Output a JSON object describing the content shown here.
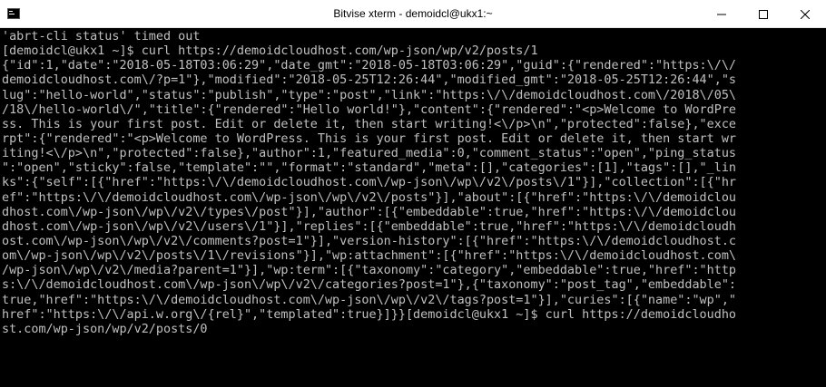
{
  "window": {
    "title": "Bitvise xterm - demoidcl@ukx1:~",
    "controls": {
      "minimize": "minimize",
      "maximize": "maximize",
      "close": "close"
    }
  },
  "terminal": {
    "lines": [
      "'abrt-cli status' timed out",
      "[demoidcl@ukx1 ~]$ curl https://demoidcloudhost.com/wp-json/wp/v2/posts/1",
      "{\"id\":1,\"date\":\"2018-05-18T03:06:29\",\"date_gmt\":\"2018-05-18T03:06:29\",\"guid\":{\"rendered\":\"https:\\/\\/",
      "demoidcloudhost.com\\/?p=1\"},\"modified\":\"2018-05-25T12:26:44\",\"modified_gmt\":\"2018-05-25T12:26:44\",\"s",
      "lug\":\"hello-world\",\"status\":\"publish\",\"type\":\"post\",\"link\":\"https:\\/\\/demoidcloudhost.com\\/2018\\/05\\",
      "/18\\/hello-world\\/\",\"title\":{\"rendered\":\"Hello world!\"},\"content\":{\"rendered\":\"<p>Welcome to WordPre",
      "ss. This is your first post. Edit or delete it, then start writing!<\\/p>\\n\",\"protected\":false},\"exce",
      "rpt\":{\"rendered\":\"<p>Welcome to WordPress. This is your first post. Edit or delete it, then start wr",
      "iting!<\\/p>\\n\",\"protected\":false},\"author\":1,\"featured_media\":0,\"comment_status\":\"open\",\"ping_status",
      "\":\"open\",\"sticky\":false,\"template\":\"\",\"format\":\"standard\",\"meta\":[],\"categories\":[1],\"tags\":[],\"_lin",
      "ks\":{\"self\":[{\"href\":\"https:\\/\\/demoidcloudhost.com\\/wp-json\\/wp\\/v2\\/posts\\/1\"}],\"collection\":[{\"hr",
      "ef\":\"https:\\/\\/demoidcloudhost.com\\/wp-json\\/wp\\/v2\\/posts\"}],\"about\":[{\"href\":\"https:\\/\\/demoidclou",
      "dhost.com\\/wp-json\\/wp\\/v2\\/types\\/post\"}],\"author\":[{\"embeddable\":true,\"href\":\"https:\\/\\/demoidclou",
      "dhost.com\\/wp-json\\/wp\\/v2\\/users\\/1\"}],\"replies\":[{\"embeddable\":true,\"href\":\"https:\\/\\/demoidcloudh",
      "ost.com\\/wp-json\\/wp\\/v2\\/comments?post=1\"}],\"version-history\":[{\"href\":\"https:\\/\\/demoidcloudhost.c",
      "om\\/wp-json\\/wp\\/v2\\/posts\\/1\\/revisions\"}],\"wp:attachment\":[{\"href\":\"https:\\/\\/demoidcloudhost.com\\",
      "/wp-json\\/wp\\/v2\\/media?parent=1\"}],\"wp:term\":[{\"taxonomy\":\"category\",\"embeddable\":true,\"href\":\"http",
      "s:\\/\\/demoidcloudhost.com\\/wp-json\\/wp\\/v2\\/categories?post=1\"},{\"taxonomy\":\"post_tag\",\"embeddable\":",
      "true,\"href\":\"https:\\/\\/demoidcloudhost.com\\/wp-json\\/wp\\/v2\\/tags?post=1\"}],\"curies\":[{\"name\":\"wp\",\"",
      "href\":\"https:\\/\\/api.w.org\\/{rel}\",\"templated\":true}]}}[demoidcl@ukx1 ~]$ curl https://demoidcloudho",
      "st.com/wp-json/wp/v2/posts/0"
    ]
  }
}
